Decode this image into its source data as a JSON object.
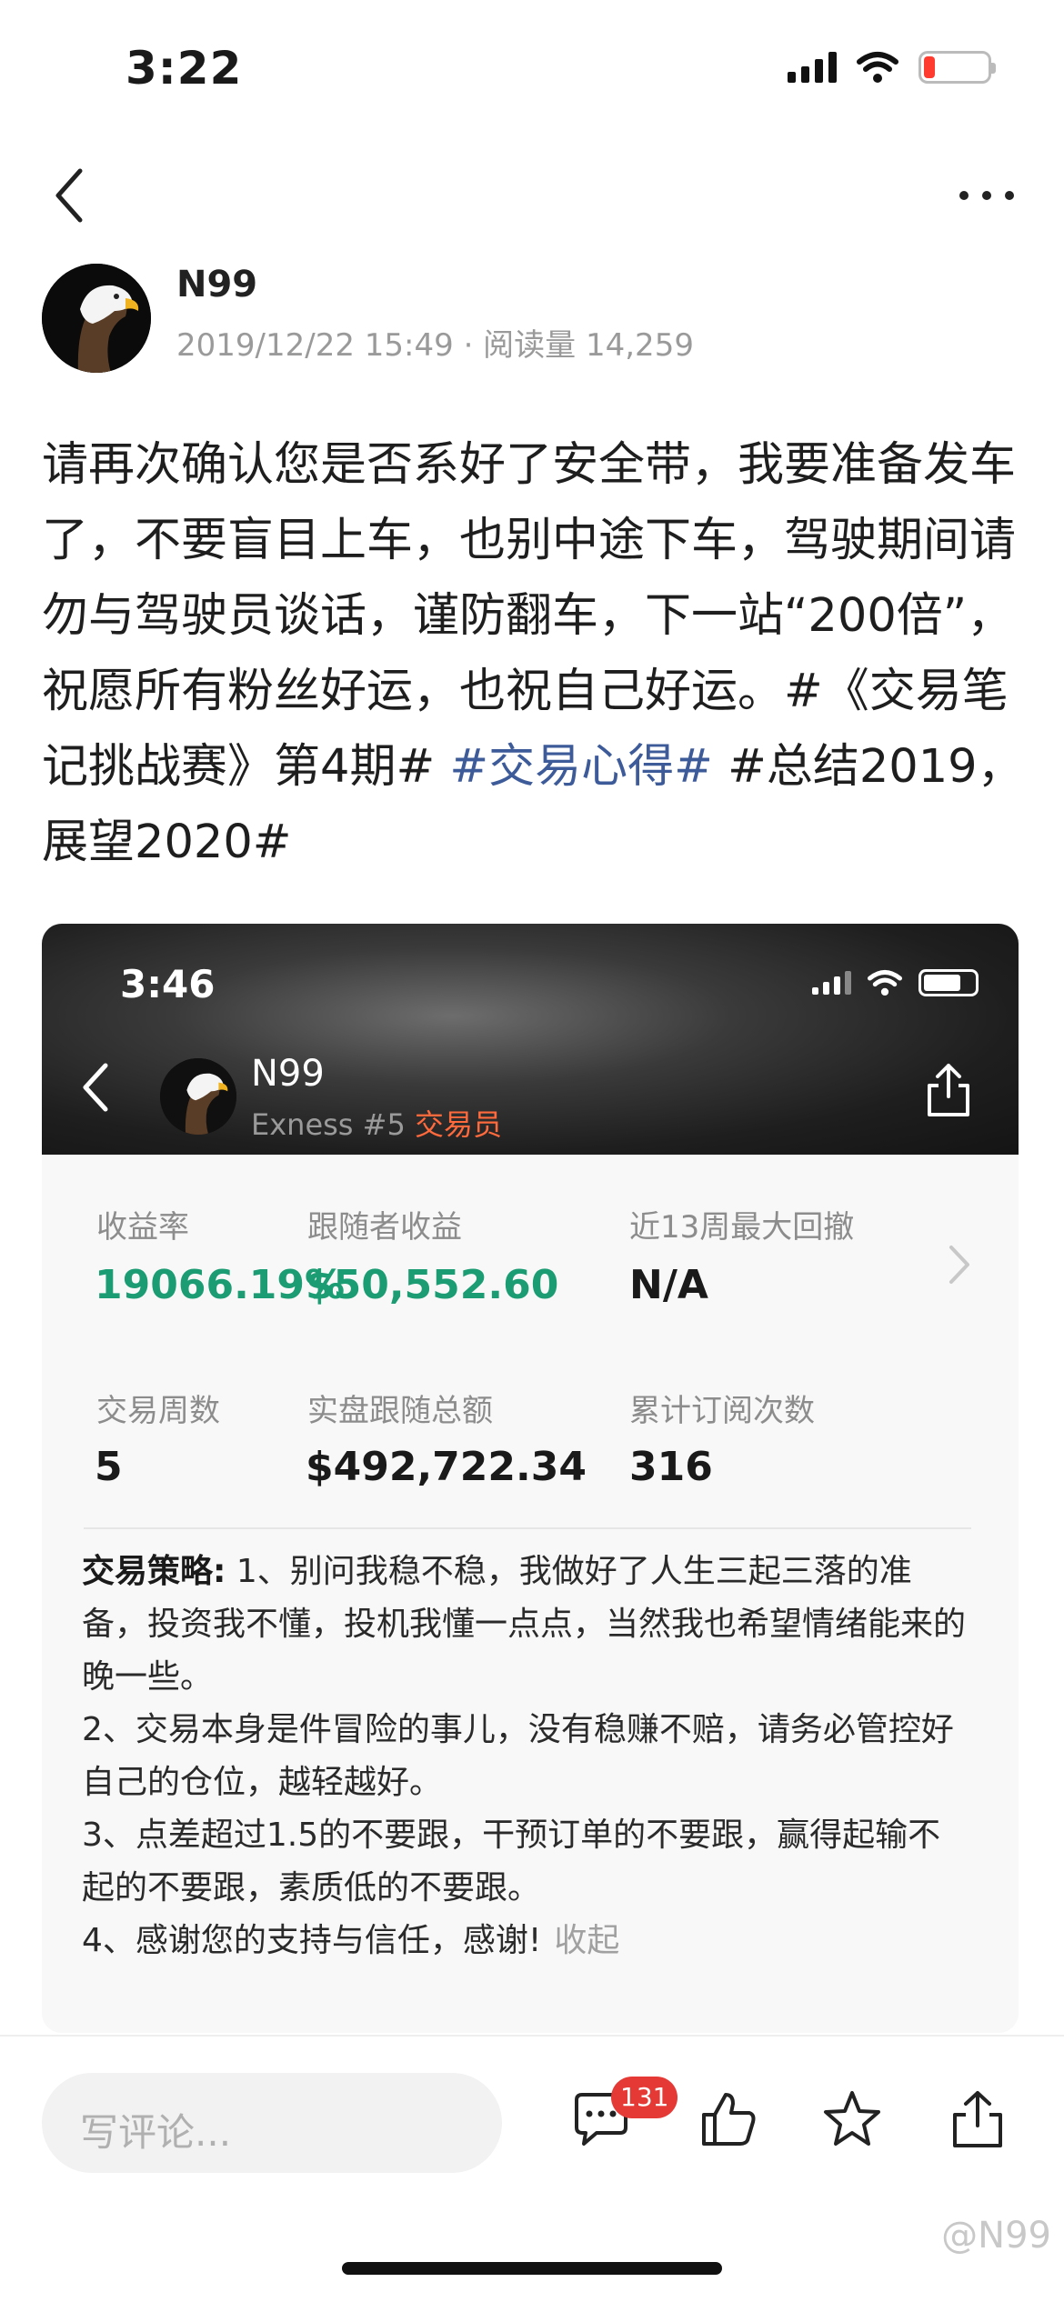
{
  "status_bar": {
    "time": "3:22",
    "signal_icon": "signal-icon",
    "wifi_icon": "wifi-icon",
    "battery_icon": "battery-low-icon",
    "battery_color": "#ff3b30"
  },
  "nav": {
    "back_icon": "chevron-left-icon",
    "more_icon": "more-dots-icon"
  },
  "author": {
    "name": "N99",
    "meta": "2019/12/22 15:49 · 阅读量 14,259"
  },
  "post": {
    "text_before": "请再次确认您是否系好了安全带，我要准备发车了，不要盲目上车，也别中途下车，驾驶期间请勿与驾驶员谈话，谨防翻车，下一站“200倍”，祝愿所有粉丝好运，也祝自己好运。#《交易笔记挑战赛》第4期# ",
    "hashtag_blue": "#交易心得#",
    "text_after": " #总结2019，展望2020#",
    "hashtag_color": "#3d5a99"
  },
  "embedded_card": {
    "status_time": "3:46",
    "name": "N99",
    "subtitle_prefix": "Exness #5 ",
    "subtitle_role": "交易员",
    "role_color": "#ff6a3d",
    "stats": [
      {
        "label": "收益率",
        "value": "19066.19%"
      },
      {
        "label": "跟随者收益",
        "value": "$50,552.60"
      },
      {
        "label": "近13周最大回撤",
        "value": "N/A"
      },
      {
        "label": "交易周数",
        "value": "5"
      },
      {
        "label": "实盘跟随总额",
        "value": "$492,722.34"
      },
      {
        "label": "累计订阅次数",
        "value": "316"
      }
    ],
    "strategy_heading": "交易策略:",
    "strategy_lines": [
      " 1、别问我稳不稳，我做好了人生三起三落的准备，投资我不懂，投机我懂一点点，当然我也希望情绪能来的晚一些。",
      "2、交易本身是件冒险的事儿，没有稳赚不赔，请务必管控好自己的仓位，越轻越好。",
      "3、点差超过1.5的不要跟，干预订单的不要跟，赢得起输不起的不要跟，素质低的不要跟。",
      "4、感谢您的支持与信任，感谢!"
    ],
    "collapse_label": "收起",
    "green_color": "#1b9c73"
  },
  "toolbar": {
    "comment_placeholder": "写评论...",
    "comment_count": "131",
    "icons": [
      "comment-icon",
      "like-icon",
      "star-icon",
      "share-icon"
    ]
  },
  "watermark": "@N99"
}
